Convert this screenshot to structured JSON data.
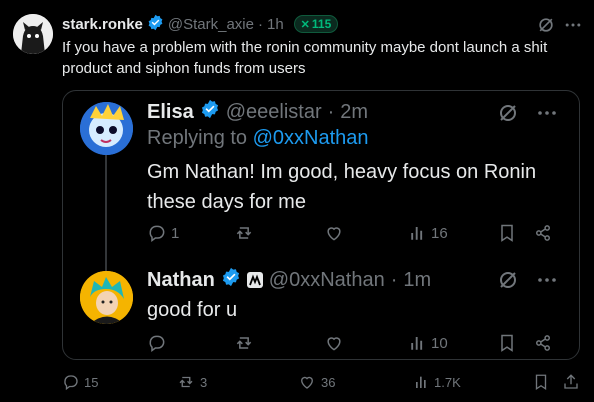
{
  "main_post": {
    "author_name": "stark.ronke",
    "handle": "@Stark_axie",
    "dot": "·",
    "time": "1h",
    "badge_value": "115",
    "text": "If you have a problem with the ronin community maybe dont launch a shit product and siphon funds from users",
    "actions": {
      "replies": "15",
      "reposts": "3",
      "likes": "36",
      "views": "1.7K"
    }
  },
  "quoted": {
    "post1": {
      "author_name": "Elisa",
      "handle": "@eeelistar",
      "dot": "·",
      "time": "2m",
      "replying_prefix": "Replying to",
      "replying_handle": "@0xxNathan",
      "text": "Gm Nathan! Im good, heavy focus on Ronin these days for me",
      "actions": {
        "replies": "1",
        "views": "16"
      }
    },
    "post2": {
      "author_name": "Nathan",
      "handle": "@0xxNathan",
      "dot": "·",
      "time": "1m",
      "text": "good for u",
      "actions": {
        "views": "10"
      }
    }
  },
  "colors": {
    "background": "#000000",
    "text": "#e7e9ea",
    "muted": "#71767b",
    "accent_blue": "#1d9bf0",
    "badge_green": "#00ba7c",
    "border": "#2f3336"
  }
}
